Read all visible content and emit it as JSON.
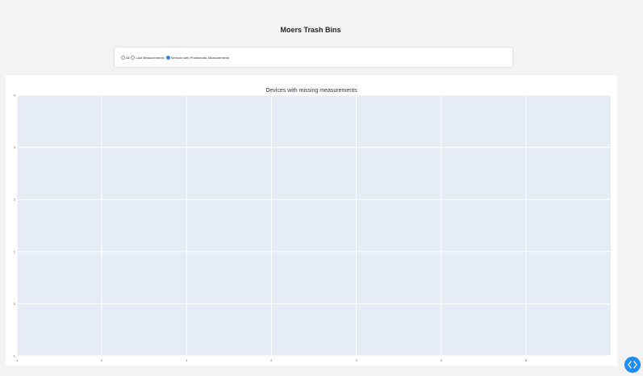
{
  "app": {
    "title": "Moers Trash Bins"
  },
  "filter": {
    "options": [
      {
        "label": "All",
        "selected": false
      },
      {
        "label": "Last Measurements",
        "selected": false
      },
      {
        "label": "Sensors with Problematic Measurements",
        "selected": true
      }
    ]
  },
  "chart_data": {
    "type": "scatter",
    "title": "Devices with missing measurements",
    "xlabel": "",
    "ylabel": "",
    "xlim": [
      -1,
      6
    ],
    "ylim": [
      -1,
      4
    ],
    "x_ticks": [
      -1,
      0,
      1,
      2,
      3,
      4,
      5
    ],
    "y_ticks": [
      -1,
      0,
      1,
      2,
      3,
      4
    ],
    "grid": true,
    "series": []
  },
  "devtools": {
    "icon": "code-brackets-icon"
  },
  "colors": {
    "plot_background": "#e5ecf6",
    "gridline": "#ffffff",
    "accent": "#1f8cf0"
  }
}
